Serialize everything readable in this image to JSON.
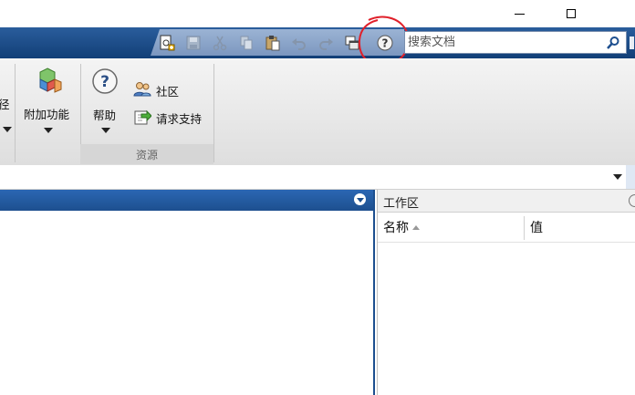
{
  "window": {
    "minimize_icon": "minimize-icon",
    "maximize_icon": "maximize-icon"
  },
  "toolbar": {
    "quick_access_icons": [
      "new-script-icon",
      "save-icon",
      "cut-icon",
      "copy-icon",
      "paste-icon",
      "undo-icon",
      "redo-icon",
      "switch-windows-icon",
      "help-icon"
    ],
    "search_placeholder": "搜索文档",
    "annotation_color": "#e0202a"
  },
  "ribbon": {
    "partial_label": "径",
    "addons": {
      "label": "附加功能"
    },
    "help": {
      "label": "帮助"
    },
    "community": {
      "label": "社区"
    },
    "request_support": {
      "label": "请求支持"
    },
    "resources_group": {
      "label": "资源"
    }
  },
  "workspace": {
    "title": "工作区",
    "columns": {
      "name": "名称",
      "value": "值"
    }
  },
  "colors": {
    "toolbar_blue": "#1d4f8f",
    "ribbon_gray": "#e6e6e6"
  }
}
